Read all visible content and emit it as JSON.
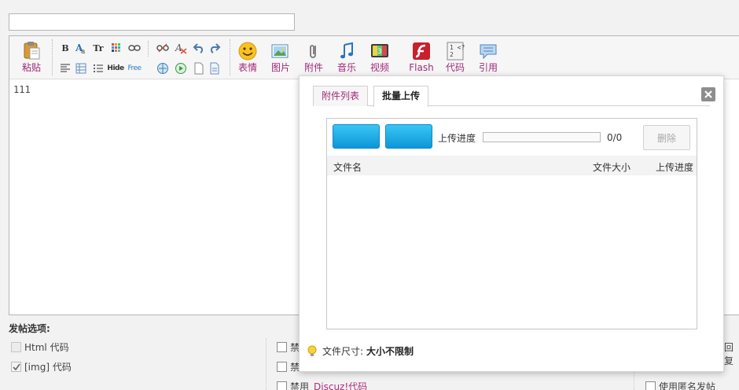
{
  "title_input": {
    "value": ""
  },
  "toolbar": {
    "paste_label": "粘贴",
    "buttons": {
      "emoji": "表情",
      "image": "图片",
      "attachment": "附件",
      "music": "音乐",
      "video": "视频",
      "flash": "Flash",
      "code": "代码",
      "quote": "引用"
    },
    "small": {
      "bold": "B",
      "font_size": "Tr",
      "hide": "Hide",
      "free": "Free"
    }
  },
  "editor": {
    "content": "111"
  },
  "post_options": {
    "title": "发帖选项:",
    "html_code": "Html 代码",
    "img_code": "[img] 代码",
    "disable_prefix_1": "禁",
    "disable_prefix_2": "禁",
    "disable_prefix_3": "禁用",
    "discuz_code": "Discuz!代码",
    "reply_partial": "回复",
    "anonymous": "使用匿名发帖"
  },
  "dialog": {
    "tabs": [
      {
        "label": "附件列表",
        "active": false
      },
      {
        "label": "批量上传",
        "active": true
      }
    ],
    "progress_label": "上传进度",
    "progress_count": "0/0",
    "progress_value": 0,
    "delete_label": "删除",
    "columns": {
      "filename": "文件名",
      "filesize": "文件大小",
      "progress": "上传进度"
    },
    "file_size_label": "文件尺寸:",
    "file_size_value": "大小不限制"
  },
  "colors": {
    "accent": "#a0297a",
    "upload_button": "#1aa6e6"
  }
}
